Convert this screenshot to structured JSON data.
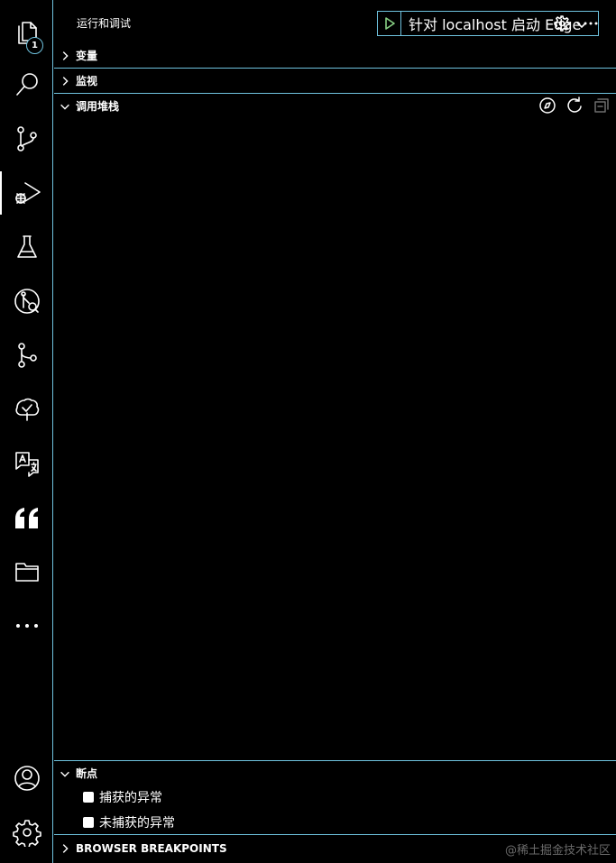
{
  "activity_bar": {
    "items": [
      {
        "name": "explorer",
        "icon": "files-icon",
        "badge": "1"
      },
      {
        "name": "search",
        "icon": "search-icon"
      },
      {
        "name": "source-control",
        "icon": "source-control-icon"
      },
      {
        "name": "run-and-debug",
        "icon": "debug-icon",
        "active": true
      },
      {
        "name": "testing",
        "icon": "beaker-icon"
      },
      {
        "name": "git-lens",
        "icon": "gitlens-icon"
      },
      {
        "name": "git-graph",
        "icon": "git-graph-icon"
      },
      {
        "name": "tree-view",
        "icon": "tree-check-icon"
      },
      {
        "name": "translate",
        "icon": "translate-icon"
      },
      {
        "name": "quotes",
        "icon": "quote-icon"
      },
      {
        "name": "folder",
        "icon": "folder-icon"
      },
      {
        "name": "more",
        "icon": "ellipsis-icon"
      }
    ],
    "bottom": [
      {
        "name": "accounts",
        "icon": "account-icon"
      },
      {
        "name": "manage",
        "icon": "gear-icon"
      }
    ]
  },
  "panel": {
    "title": "运行和调试",
    "launch_config": "针对 localhost 启动 Edge",
    "sections": {
      "variables": "变量",
      "watch": "监视",
      "call_stack": "调用堆栈",
      "breakpoints": "断点",
      "browser_breakpoints": "BROWSER BREAKPOINTS"
    },
    "breakpoints": [
      {
        "label": "捕获的异常",
        "checked": false
      },
      {
        "label": "未捕获的异常",
        "checked": false
      }
    ]
  },
  "watermark": "@稀土掘金技术社区",
  "colors": {
    "border": "#6fc3df",
    "play": "#89d185",
    "background": "#000000"
  }
}
